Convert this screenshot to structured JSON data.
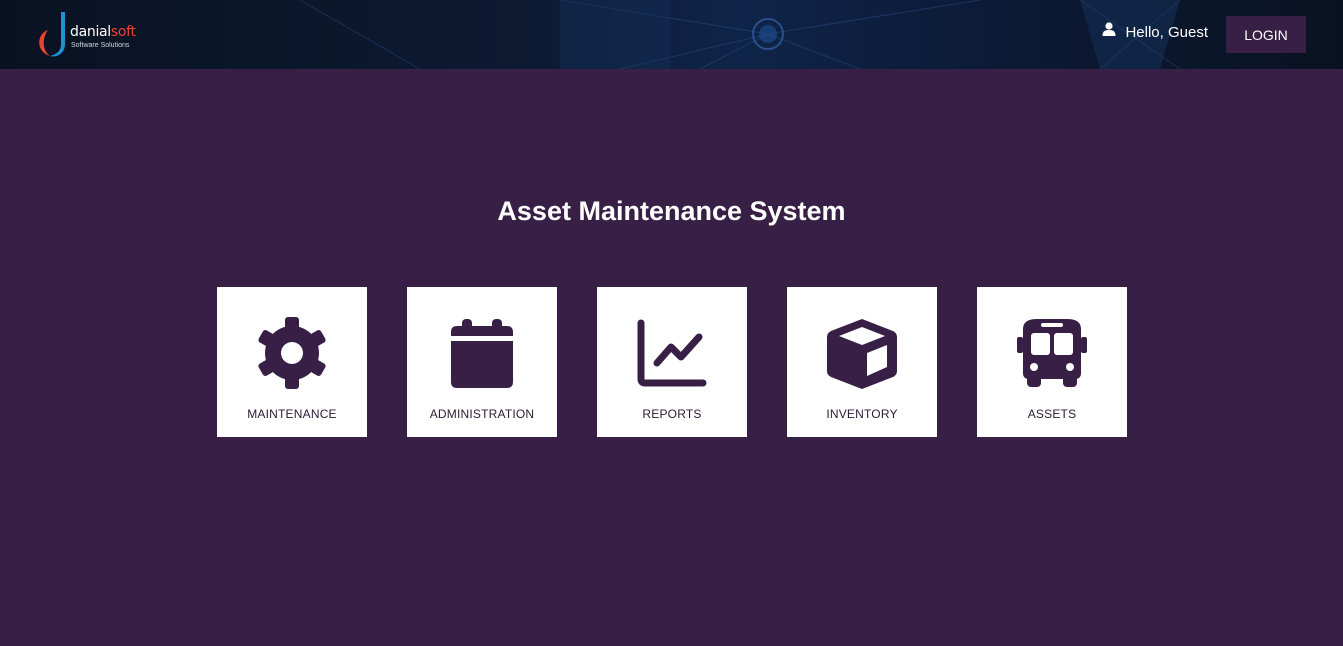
{
  "header": {
    "logo": {
      "name_part1": "danial",
      "name_part2": "soft",
      "tagline": "Software Solutions"
    },
    "greeting": "Hello, Guest",
    "login_label": "LOGIN"
  },
  "main": {
    "title": "Asset Maintenance System",
    "tiles": [
      {
        "label": "MAINTENANCE",
        "icon": "gear-icon"
      },
      {
        "label": "ADMINISTRATION",
        "icon": "calendar-icon"
      },
      {
        "label": "REPORTS",
        "icon": "line-chart-icon"
      },
      {
        "label": "INVENTORY",
        "icon": "box-icon"
      },
      {
        "label": "ASSETS",
        "icon": "bus-icon"
      }
    ]
  },
  "colors": {
    "background": "#371f45",
    "header_background": "#0d1a33",
    "tile_background": "#ffffff",
    "icon_color": "#371f45",
    "logo_accent": "#e8452f",
    "logo_blue": "#1f8fd6"
  }
}
